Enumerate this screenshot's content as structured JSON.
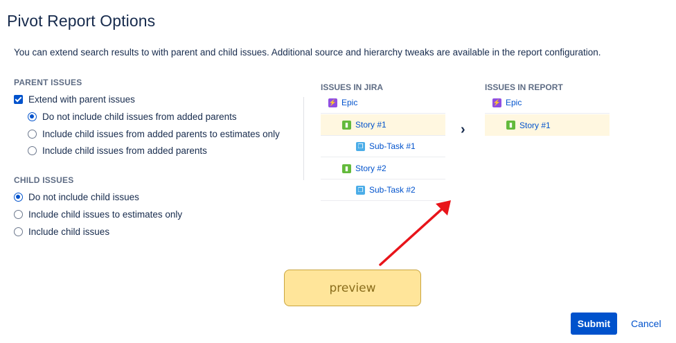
{
  "page": {
    "title": "Pivot Report Options",
    "intro": "You can extend search results to with parent and child issues. Additional source and hierarchy tweaks are available in the report configuration."
  },
  "parent_issues": {
    "heading": "PARENT ISSUES",
    "extend_label": "Extend with parent issues",
    "extend_checked": true,
    "options": [
      {
        "label": "Do not include child issues from added parents",
        "selected": true
      },
      {
        "label": "Include child issues from added parents to estimates only",
        "selected": false
      },
      {
        "label": "Include child issues from added parents",
        "selected": false
      }
    ]
  },
  "child_issues": {
    "heading": "CHILD ISSUES",
    "options": [
      {
        "label": "Do not include child issues",
        "selected": true
      },
      {
        "label": "Include child issues to estimates only",
        "selected": false
      },
      {
        "label": "Include child issues",
        "selected": false
      }
    ]
  },
  "jira_tree": {
    "heading": "ISSUES IN JIRA",
    "items": [
      {
        "label": "Epic",
        "type": "epic",
        "icon": "lightning-icon"
      },
      {
        "label": "Story #1",
        "type": "story",
        "icon": "bookmark-icon",
        "highlighted": true
      },
      {
        "label": "Sub-Task #1",
        "type": "subtask",
        "icon": "subtask-icon"
      },
      {
        "label": "Story #2",
        "type": "story",
        "icon": "bookmark-icon"
      },
      {
        "label": "Sub-Task #2",
        "type": "subtask",
        "icon": "subtask-icon"
      }
    ]
  },
  "report_tree": {
    "heading": "ISSUES IN REPORT",
    "items": [
      {
        "label": "Epic",
        "type": "epic",
        "icon": "lightning-icon"
      },
      {
        "label": "Story #1",
        "type": "story",
        "icon": "bookmark-icon",
        "highlighted": true
      }
    ]
  },
  "annotation": {
    "label": "preview",
    "arrow_color": "#e8141a"
  },
  "actions": {
    "submit_label": "Submit",
    "cancel_label": "Cancel"
  },
  "colors": {
    "primary": "#0052cc",
    "highlight_row": "#fff7e0",
    "epic": "#904ee2",
    "story": "#63ba3c",
    "subtask": "#4bade8"
  }
}
